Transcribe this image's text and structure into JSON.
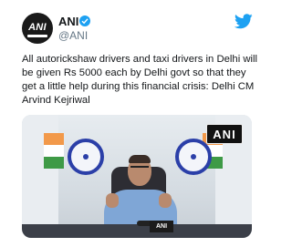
{
  "author": {
    "display_name": "ANI",
    "handle": "@ANI",
    "avatar_text": "ANI"
  },
  "tweet": {
    "text": "All autorickshaw drivers and taxi drivers in Delhi will be given Rs 5000 each by Delhi govt so that they get a little help during this financial crisis: Delhi CM Arvind Kejriwal"
  },
  "media": {
    "watermark": "ANI"
  },
  "colors": {
    "twitter_blue": "#1da1f2",
    "text": "#14171a",
    "secondary_text": "#657786"
  },
  "icons": {
    "verified": "verified-badge-icon",
    "twitter": "twitter-bird-icon"
  }
}
